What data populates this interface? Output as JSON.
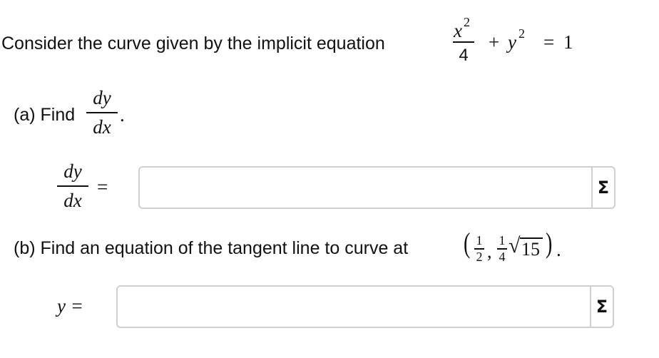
{
  "intro": {
    "text": "Consider the curve given by the implicit equation",
    "equation": {
      "x_numerator": "x",
      "x_power": "2",
      "x_denominator": "4",
      "plus": "+",
      "y": "y",
      "y_power": "2",
      "equals": "=",
      "rhs": "1"
    }
  },
  "part_a": {
    "prompt": "(a) Find",
    "derivative_numerator": "dy",
    "derivative_denominator": "dx",
    "period": ".",
    "answer_label_numerator": "dy",
    "answer_label_denominator": "dx",
    "answer_equals": "=",
    "answer_value": "",
    "sigma_label": "Σ"
  },
  "part_b": {
    "prompt": "(b) Find an equation of the tangent line to curve at",
    "point": {
      "open_paren": "(",
      "x_num": "1",
      "x_den": "2",
      "comma": ",",
      "y_num": "1",
      "y_den": "4",
      "radical": "√",
      "radicand": "15",
      "close_paren": ")",
      "period": "."
    },
    "answer_label": "y =",
    "answer_value": "",
    "sigma_label": "Σ"
  }
}
